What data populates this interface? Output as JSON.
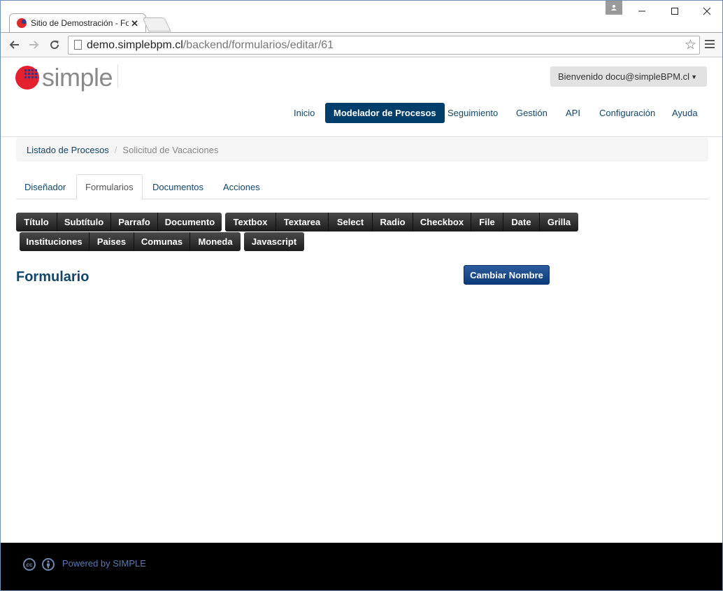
{
  "browser": {
    "tab_title": "Sitio de Demostración - Fo",
    "tab_close": "✕",
    "url_host": "demo.simplebpm.cl",
    "url_path": "/backend/formularios/editar/61"
  },
  "header": {
    "logo_text": "simple",
    "welcome": "Bienvenido docu@simpleBPM.cl"
  },
  "nav": {
    "items": [
      "Inicio",
      "Modelador de Procesos",
      "Seguimiento",
      "Gestión",
      "API",
      "Configuración",
      "Ayuda"
    ]
  },
  "breadcrumb": {
    "parent": "Listado de Procesos",
    "separator": "/",
    "current": "Solicitud de Vacaciones"
  },
  "tabs": [
    "Diseñador",
    "Formularios",
    "Documentos",
    "Acciones"
  ],
  "toolbar": {
    "row1_group1": [
      "Título",
      "Subtítulo",
      "Parrafo",
      "Documento"
    ],
    "row1_group2": [
      "Textbox",
      "Textarea",
      "Select",
      "Radio",
      "Checkbox",
      "File",
      "Date",
      "Grilla"
    ],
    "row2_group1": [
      "Instituciones",
      "Paises",
      "Comunas",
      "Moneda"
    ],
    "row2_group2": [
      "Javascript"
    ]
  },
  "main": {
    "title": "Formulario",
    "rename_button": "Cambiar Nombre"
  },
  "footer": {
    "text": "Powered by SIMPLE"
  },
  "colors": {
    "nav_active": "#003f6b",
    "link": "#13476a",
    "footer_bg": "#000000"
  }
}
